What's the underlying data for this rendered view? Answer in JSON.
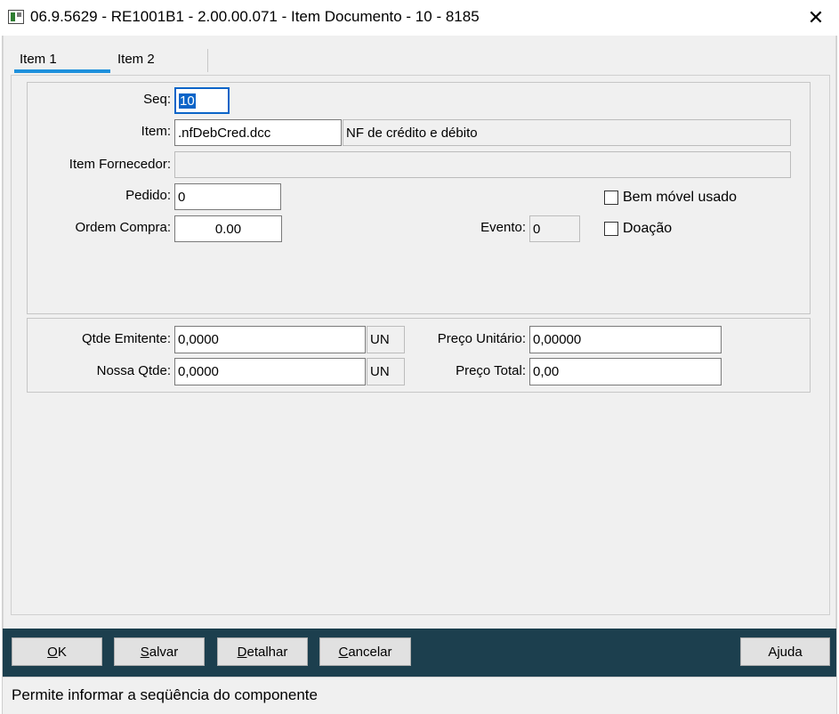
{
  "window": {
    "title": "06.9.5629 - RE1001B1 - 2.00.00.071 - Item Documento - 10 - 8185",
    "close_glyph": "✕"
  },
  "tabs": [
    {
      "label": "Item 1",
      "active": true
    },
    {
      "label": "Item 2",
      "active": false
    }
  ],
  "form": {
    "seq_label": "Seq:",
    "seq_value": "10",
    "item_label": "Item:",
    "item_code": ".nfDebCred.dcc",
    "item_description": "NF de crédito e débito",
    "item_fornecedor_label": "Item Fornecedor:",
    "item_fornecedor_value": "",
    "pedido_label": "Pedido:",
    "pedido_value": "0",
    "ordem_compra_label": "Ordem Compra:",
    "ordem_compra_value": "0.00",
    "evento_label": "Evento:",
    "evento_value": "0",
    "bem_movel_label": "Bem móvel usado",
    "bem_movel_checked": false,
    "doacao_label": "Doação",
    "doacao_checked": false
  },
  "quantities": {
    "qtde_emitente_label": "Qtde Emitente:",
    "qtde_emitente_value": "0,0000",
    "qtde_emitente_unit": "UN",
    "nossa_qtde_label": "Nossa Qtde:",
    "nossa_qtde_value": "0,0000",
    "nossa_qtde_unit": "UN",
    "preco_unitario_label": "Preço Unitário:",
    "preco_unitario_value": "0,00000",
    "preco_total_label": "Preço Total:",
    "preco_total_value": "0,00"
  },
  "buttons": {
    "ok_mnemonic": "O",
    "ok_rest": "K",
    "salvar_mnemonic": "S",
    "salvar_rest": "alvar",
    "detalhar_mnemonic": "D",
    "detalhar_rest": "etalhar",
    "cancelar_mnemonic": "C",
    "cancelar_rest": "ancelar",
    "ajuda_label": "Ajuda"
  },
  "status": {
    "message": "Permite informar a seqüência do componente"
  },
  "colors": {
    "accent_tab": "#1e90dc",
    "button_bar": "#1c3f4e",
    "selection": "#0a64c8"
  }
}
